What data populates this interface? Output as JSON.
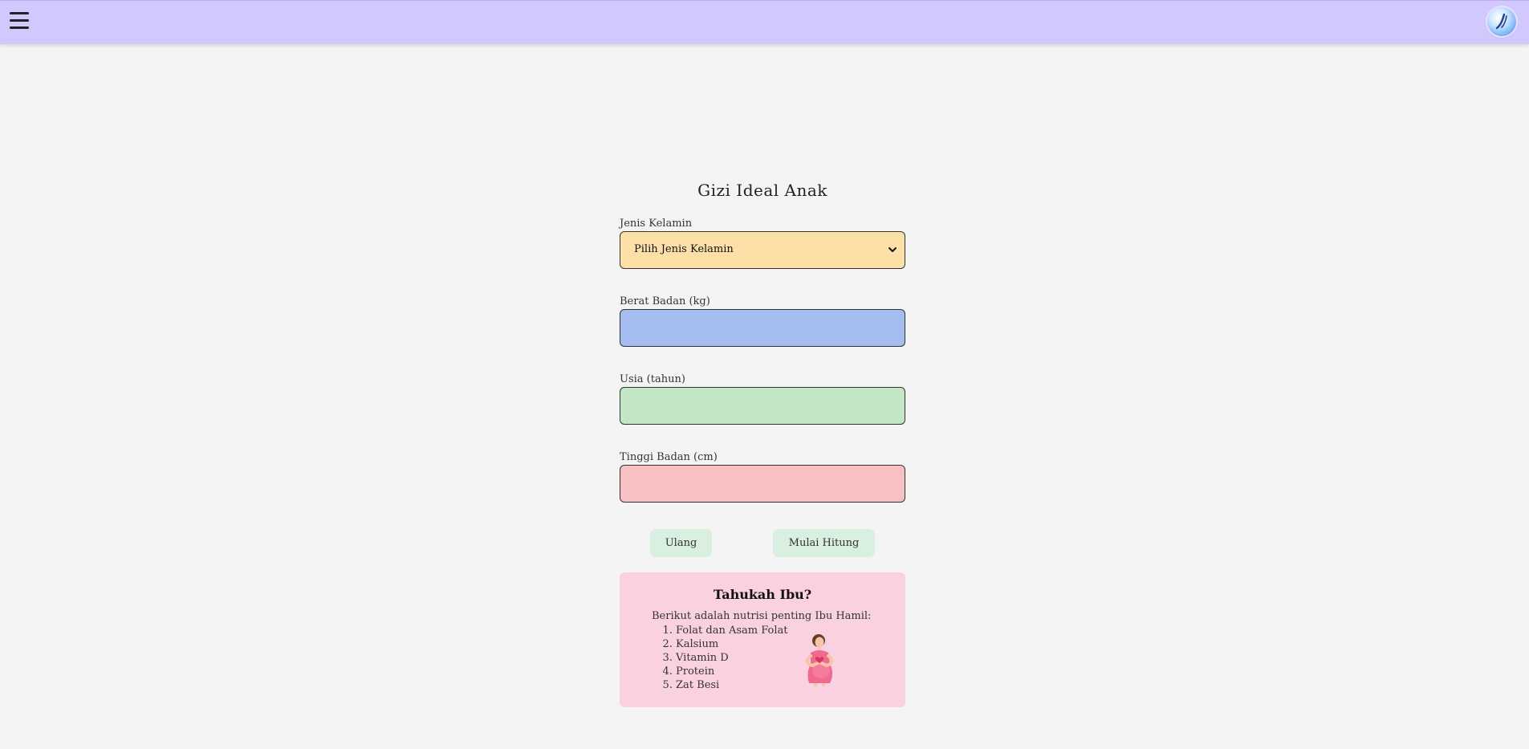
{
  "header": {
    "menu_icon": "hamburger-menu-icon",
    "logo_icon": "app-logo-icon"
  },
  "page": {
    "title": "Gizi Ideal Anak"
  },
  "form": {
    "gender": {
      "label": "Jenis Kelamin",
      "selected": "Pilih Jenis Kelamin",
      "color": "#fde0a8"
    },
    "weight": {
      "label": "Berat Badan (kg)",
      "value": "",
      "color": "#a4bcf0"
    },
    "age": {
      "label": "Usia (tahun)",
      "value": "",
      "color": "#c3e6c7"
    },
    "height": {
      "label": "Tinggi Badan (cm)",
      "value": "",
      "color": "#f7c1c3"
    },
    "reset_label": "Ulang",
    "submit_label": "Mulai Hitung"
  },
  "info": {
    "title": "Tahukah Ibu?",
    "intro": "Berikut adalah nutrisi penting Ibu Hamil:",
    "items": [
      "Folat dan Asam Folat",
      "Kalsium",
      "Vitamin D",
      "Protein",
      "Zat Besi"
    ],
    "illustration_icon": "pregnant-mother-illustration"
  },
  "colors": {
    "header_bg": "#d3c8fd",
    "page_bg": "#f4f4f5",
    "button_bg": "#d9efdf",
    "info_bg": "#fad1e0"
  }
}
